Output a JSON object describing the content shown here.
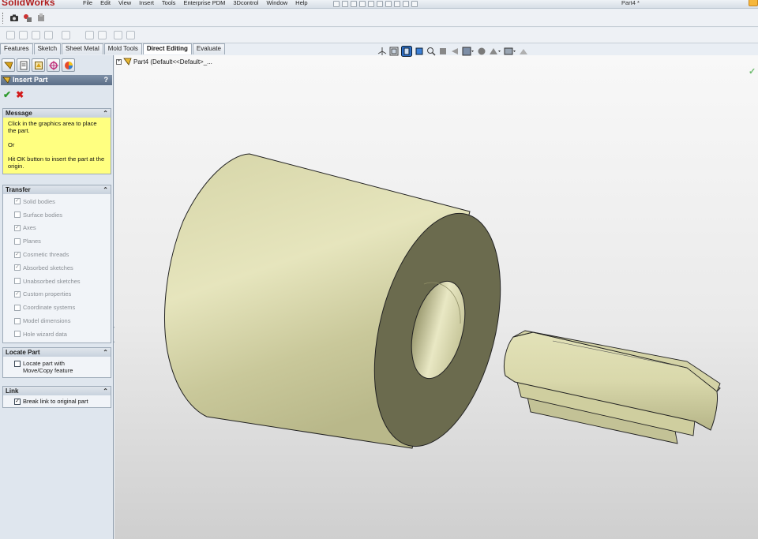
{
  "app": {
    "logo_text": "SolidWorks",
    "document_title": "Part4 *"
  },
  "menu": [
    "File",
    "Edit",
    "View",
    "Insert",
    "Tools",
    "Enterprise PDM",
    "3Dcontrol",
    "Window",
    "Help"
  ],
  "tabs": [
    {
      "label": "Features",
      "active": false
    },
    {
      "label": "Sketch",
      "active": false
    },
    {
      "label": "Sheet Metal",
      "active": false
    },
    {
      "label": "Mold Tools",
      "active": false
    },
    {
      "label": "Direct Editing",
      "active": true
    },
    {
      "label": "Evaluate",
      "active": false
    }
  ],
  "property_manager": {
    "title": "Insert Part",
    "help": "?",
    "ok": "✔",
    "cancel": "✖",
    "message": {
      "header": "Message",
      "line1": "Click in the graphics area to place the part.",
      "line2": "Or",
      "line3": "Hit OK button to insert the part at the origin."
    },
    "transfer": {
      "header": "Transfer",
      "items": [
        {
          "label": "Solid bodies",
          "checked": true
        },
        {
          "label": "Surface bodies",
          "checked": false
        },
        {
          "label": "Axes",
          "checked": true
        },
        {
          "label": "Planes",
          "checked": false
        },
        {
          "label": "Cosmetic threads",
          "checked": true
        },
        {
          "label": "Absorbed sketches",
          "checked": true
        },
        {
          "label": "Unabsorbed sketches",
          "checked": false
        },
        {
          "label": "Custom properties",
          "checked": true
        },
        {
          "label": "Coordinate systems",
          "checked": false
        },
        {
          "label": "Model dimensions",
          "checked": false
        },
        {
          "label": "Hole wizard data",
          "checked": false
        }
      ]
    },
    "locate": {
      "header": "Locate Part",
      "option": "Locate part with Move/Copy feature",
      "checked": false
    },
    "link": {
      "header": "Link",
      "option": "Break link to original part",
      "checked": true
    }
  },
  "feature_tree": {
    "expander": "+",
    "label": "Part4  (Default<<Default>_..."
  },
  "colors": {
    "model_face": "#dcdcaa",
    "model_shadow": "#6b6b4e",
    "message_bg": "#ffff80",
    "header_bar": "#6a7c94"
  }
}
